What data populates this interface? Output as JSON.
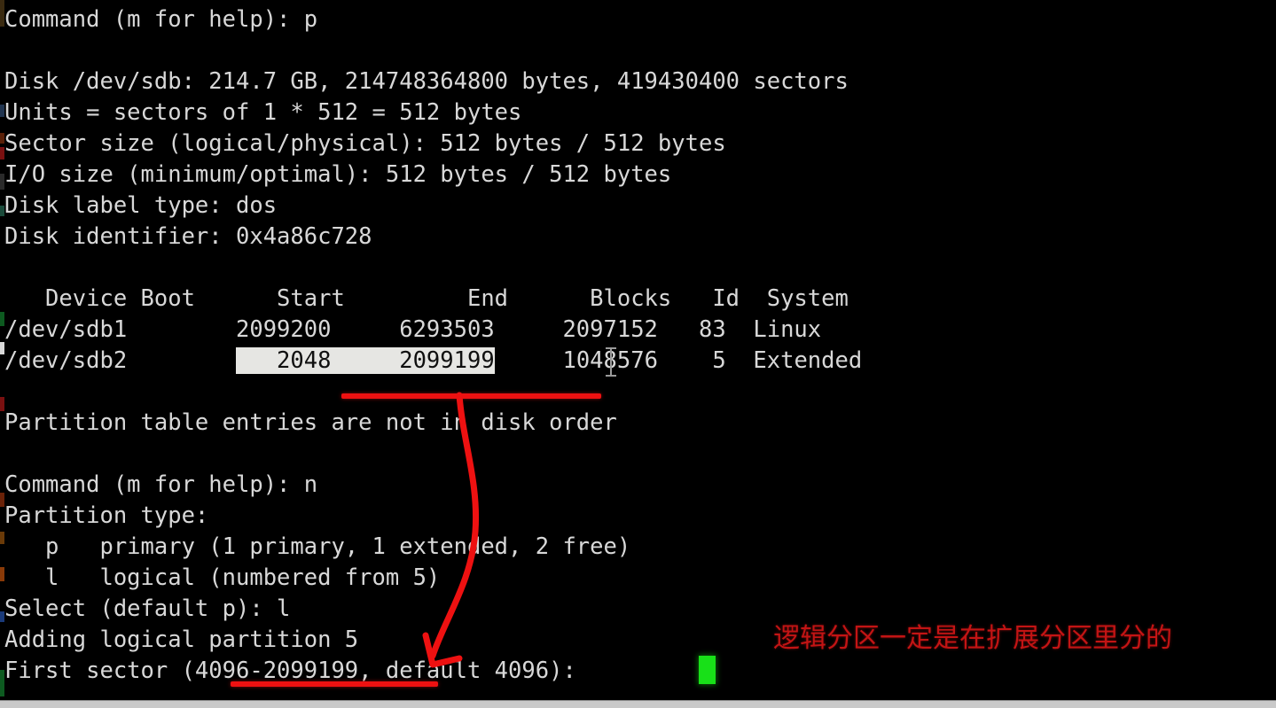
{
  "terminal": {
    "title": "fdisk partition editor session",
    "background_color": "#000000",
    "foreground_color": "#d8d8d8",
    "selection_bg_color": "#e6e6e3",
    "selection_fg_color": "#101010",
    "cursor_color": "#18e018",
    "annotation_color": "#ee1111",
    "lines": [
      {
        "id": "l01",
        "text": "Command (m for help): p"
      },
      {
        "id": "l02",
        "text": ""
      },
      {
        "id": "l03",
        "text": "Disk /dev/sdb: 214.7 GB, 214748364800 bytes, 419430400 sectors"
      },
      {
        "id": "l04",
        "text": "Units = sectors of 1 * 512 = 512 bytes"
      },
      {
        "id": "l05",
        "text": "Sector size (logical/physical): 512 bytes / 512 bytes"
      },
      {
        "id": "l06",
        "text": "I/O size (minimum/optimal): 512 bytes / 512 bytes"
      },
      {
        "id": "l07",
        "text": "Disk label type: dos"
      },
      {
        "id": "l08",
        "text": "Disk identifier: 0x4a86c728"
      },
      {
        "id": "l09",
        "text": ""
      },
      {
        "id": "l10",
        "text": "   Device Boot      Start         End      Blocks   Id  System"
      },
      {
        "id": "l11",
        "text": "/dev/sdb1        2099200     6293503     2097152   83  Linux"
      },
      {
        "id": "l12",
        "text": "",
        "segments": [
          {
            "text": "/dev/sdb2        ",
            "selected": false
          },
          {
            "text": "   2048     2099199",
            "selected": true
          },
          {
            "text": "     1048576    5  Extended",
            "selected": false
          }
        ]
      },
      {
        "id": "l13",
        "text": ""
      },
      {
        "id": "l14",
        "text": "Partition table entries are not in disk order"
      },
      {
        "id": "l15",
        "text": ""
      },
      {
        "id": "l16",
        "text": "Command (m for help): n"
      },
      {
        "id": "l17",
        "text": "Partition type:"
      },
      {
        "id": "l18",
        "text": "   p   primary (1 primary, 1 extended, 2 free)"
      },
      {
        "id": "l19",
        "text": "   l   logical (numbered from 5)"
      },
      {
        "id": "l20",
        "text": "Select (default p): l"
      },
      {
        "id": "l21",
        "text": "Adding logical partition 5"
      },
      {
        "id": "l22",
        "text": "First sector (4096-2099199, default 4096): "
      }
    ]
  },
  "partition_table": {
    "headers": [
      "Device",
      "Boot",
      "Start",
      "End",
      "Blocks",
      "Id",
      "System"
    ],
    "rows": [
      {
        "device": "/dev/sdb1",
        "boot": "",
        "start": "2099200",
        "end": "6293503",
        "blocks": "2097152",
        "id": "83",
        "system": "Linux"
      },
      {
        "device": "/dev/sdb2",
        "boot": "",
        "start": "2048",
        "end": "2099199",
        "blocks": "1048576",
        "id": "5",
        "system": "Extended"
      }
    ],
    "note": "Partition table entries are not in disk order"
  },
  "disk_info": {
    "device": "/dev/sdb",
    "size_human": "214.7 GB",
    "size_bytes": "214748364800 bytes",
    "sectors": "419430400 sectors",
    "units": "sectors of 1 * 512 = 512 bytes",
    "sector_size": "512 bytes / 512 bytes",
    "io_size": "512 bytes / 512 bytes",
    "label_type": "dos",
    "identifier": "0x4a86c728"
  },
  "prompt": {
    "current": "First sector (4096-2099199, default 4096): ",
    "range_min": "4096",
    "range_max": "2099199",
    "default_value": "4096",
    "typed_value": ""
  },
  "annotations": {
    "chinese_note": "逻辑分区一定是在扩展分区里分的",
    "underline_extended_target": "2048     2099199",
    "underline_range_target": "(4096-2099199,",
    "arrow_meaning": "extended-partition-range-points-to-first-sector-range"
  }
}
